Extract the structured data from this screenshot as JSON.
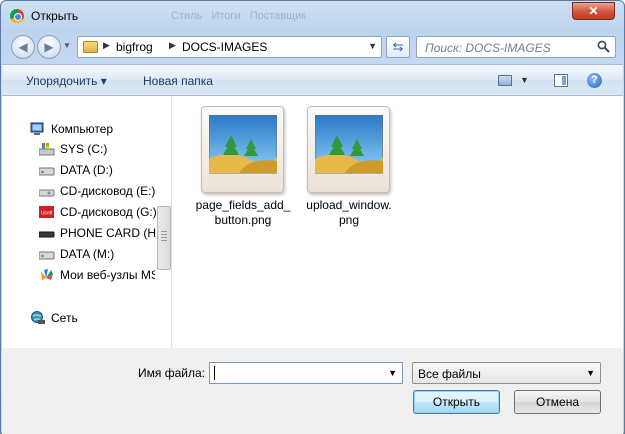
{
  "window": {
    "title": "Открыть",
    "ghost_tabs": "Стиль     Итоги     Поставщик",
    "close_label": "✕"
  },
  "nav": {
    "breadcrumb": [
      "bigfrog",
      "DOCS-IMAGES"
    ],
    "search_placeholder": "Поиск: DOCS-IMAGES"
  },
  "toolbar": {
    "organize_label": "Упорядочить ▾",
    "new_folder_label": "Новая папка"
  },
  "sidebar": {
    "items": [
      {
        "label": "Компьютер",
        "icon": "computer-icon"
      },
      {
        "label": "SYS (C:)",
        "icon": "system-drive-icon"
      },
      {
        "label": "DATA (D:)",
        "icon": "hard-drive-icon"
      },
      {
        "label": "CD-дисковод (E:)",
        "icon": "cd-drive-icon"
      },
      {
        "label": "CD-дисковод (G:)",
        "icon": "usb-modem-icon"
      },
      {
        "label": "PHONE CARD (H:)",
        "icon": "removable-drive-icon"
      },
      {
        "label": "DATA (M:)",
        "icon": "hard-drive-icon"
      },
      {
        "label": "Мои веб-узлы MSN",
        "icon": "msn-icon"
      },
      {
        "label": "Сеть",
        "icon": "network-icon"
      }
    ]
  },
  "files": [
    {
      "name_line1": "page_fields_add_",
      "name_line2": "button.png",
      "icon": "image-file-icon"
    },
    {
      "name_line1": "upload_window.",
      "name_line2": "png",
      "icon": "image-file-icon"
    }
  ],
  "footer": {
    "filename_label": "Имя файла:",
    "filename_value": "",
    "filter_value": "Все файлы",
    "open_label": "Открыть",
    "cancel_label": "Отмена"
  }
}
